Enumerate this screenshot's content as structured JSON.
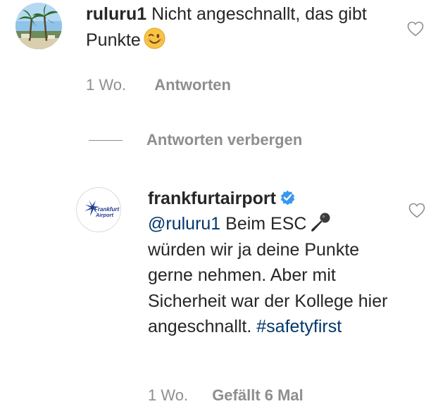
{
  "comment": {
    "username": "ruluru1",
    "text": "Nicht angeschnallt, das gibt Punkte",
    "emoji_icon": "winking-face-icon",
    "time": "1 Wo.",
    "reply_label": "Antworten",
    "like_icon": "heart-outline-icon"
  },
  "hide_replies": {
    "label": "Antworten verbergen"
  },
  "reply": {
    "username": "frankfurtairport",
    "verified_icon": "verified-badge-icon",
    "avatar_logo": "Frankfurt Airport",
    "mention": "@ruluru1",
    "text_before_emoji": "Beim ESC",
    "emoji_icon": "microphone-icon",
    "text_after_emoji": "würden wir ja deine Punkte gerne nehmen. Aber mit Sicherheit war der Kollege hier angeschnallt.",
    "hashtag": "#safetyfirst",
    "time": "1 Wo.",
    "likes": "Gefällt 6 Mal",
    "like_icon": "heart-outline-icon"
  },
  "colors": {
    "text": "#262626",
    "secondary": "#8e8e8e",
    "link": "#00376b",
    "verified": "#3897f0"
  }
}
